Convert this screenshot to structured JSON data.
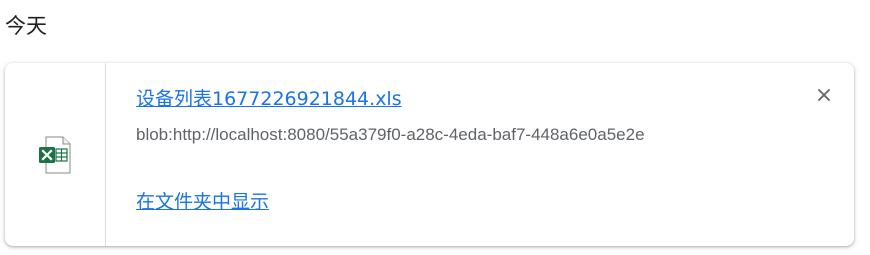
{
  "section": {
    "heading": "今天"
  },
  "download": {
    "file_name": "设备列表1677226921844.xls",
    "source_url": "blob:http://localhost:8080/55a379f0-a28c-4eda-baf7-448a6e0a5e2e",
    "show_in_folder_label": "在文件夹中显示",
    "file_icon": "excel-file-icon",
    "remove_icon": "close-icon"
  },
  "colors": {
    "link": "#1a73e8",
    "secondary_text": "#5f6368",
    "excel_green": "#1e7145"
  }
}
